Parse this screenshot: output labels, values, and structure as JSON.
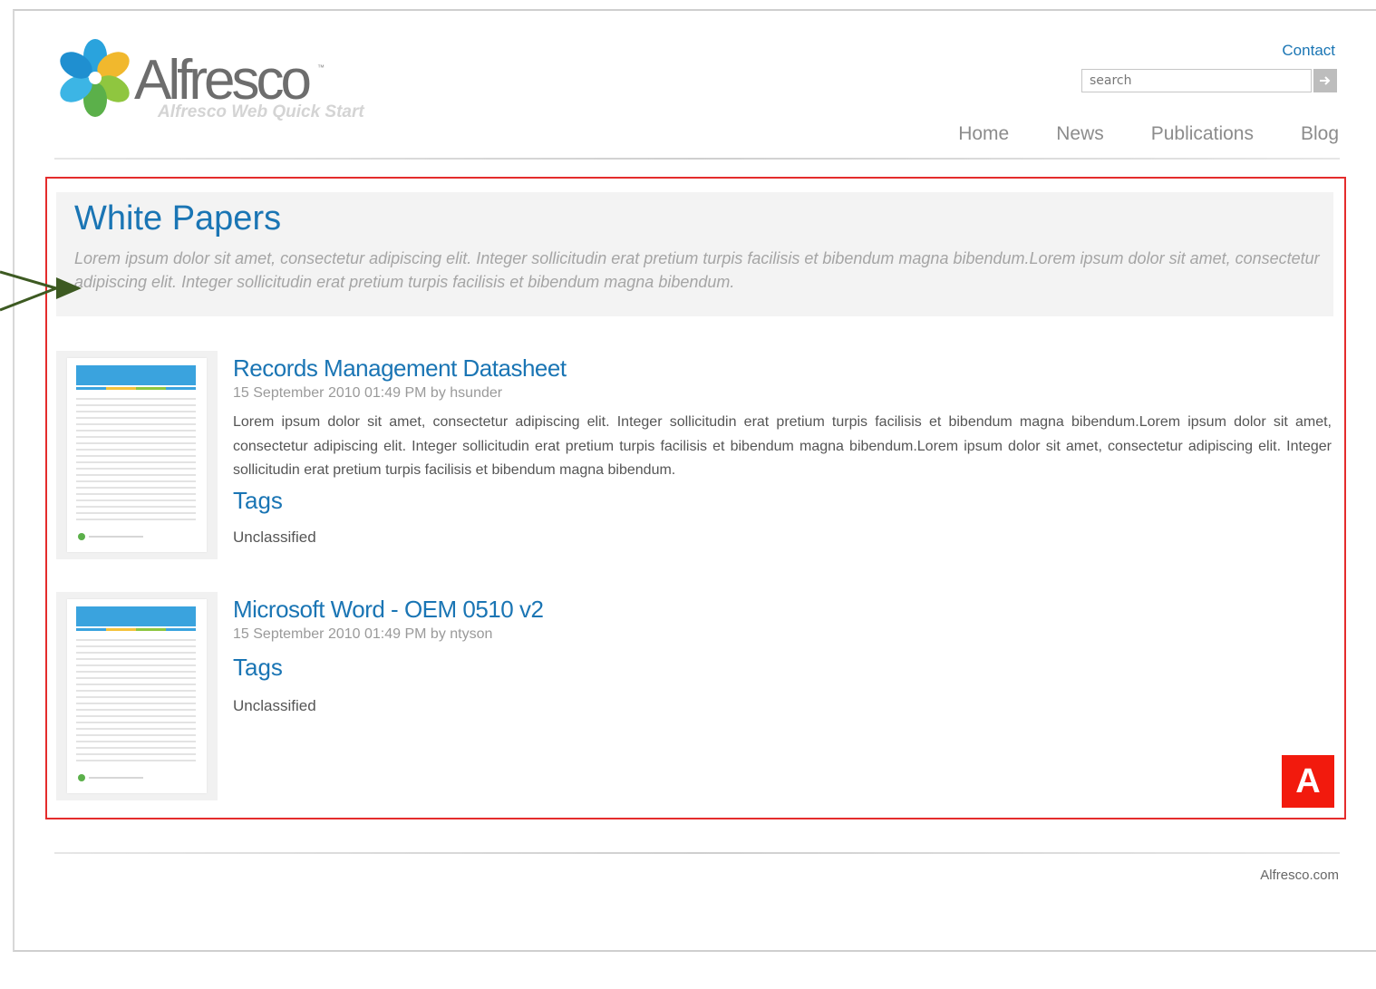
{
  "header": {
    "logo_text": "Alfresco",
    "logo_tm": "™",
    "site_subtitle": "Alfresco Web Quick Start",
    "contact_label": "Contact",
    "search": {
      "placeholder": "search",
      "value": "",
      "button_icon": "arrow-right-icon"
    },
    "nav": [
      {
        "label": "Home"
      },
      {
        "label": "News"
      },
      {
        "label": "Publications"
      },
      {
        "label": "Blog"
      }
    ]
  },
  "section": {
    "title": "White Papers",
    "description": "Lorem ipsum dolor sit amet, consectetur adipiscing elit. Integer sollicitudin erat pretium turpis facilisis et bibendum magna bibendum.Lorem ipsum dolor sit amet, consectetur adipiscing elit. Integer sollicitudin erat pretium turpis facilisis et bibendum magna bibendum."
  },
  "items": [
    {
      "title": "Records Management Datasheet",
      "meta": "15 September 2010 01:49 PM by hsunder",
      "body": "Lorem ipsum dolor sit amet, consectetur adipiscing elit. Integer sollicitudin erat pretium turpis facilisis et bibendum magna bibendum.Lorem ipsum dolor sit amet, consectetur adipiscing elit. Integer sollicitudin erat pretium turpis facilisis et bibendum magna bibendum.Lorem ipsum dolor sit amet, consectetur adipiscing elit. Integer sollicitudin erat pretium turpis facilisis et bibendum magna bibendum.",
      "tags_heading": "Tags",
      "tag": "Unclassified"
    },
    {
      "title": "Microsoft Word - OEM 0510 v2",
      "meta": "15 September 2010 01:49 PM by ntyson",
      "tags_heading": "Tags",
      "tag": "Unclassified"
    }
  ],
  "annotation": {
    "badge": "A",
    "color": "#e42c2c",
    "arrow_color": "#3d5a22"
  },
  "colors": {
    "link_blue": "#1a75b4",
    "badge_red": "#f21a0d"
  },
  "footer": {
    "link": "Alfresco.com"
  }
}
